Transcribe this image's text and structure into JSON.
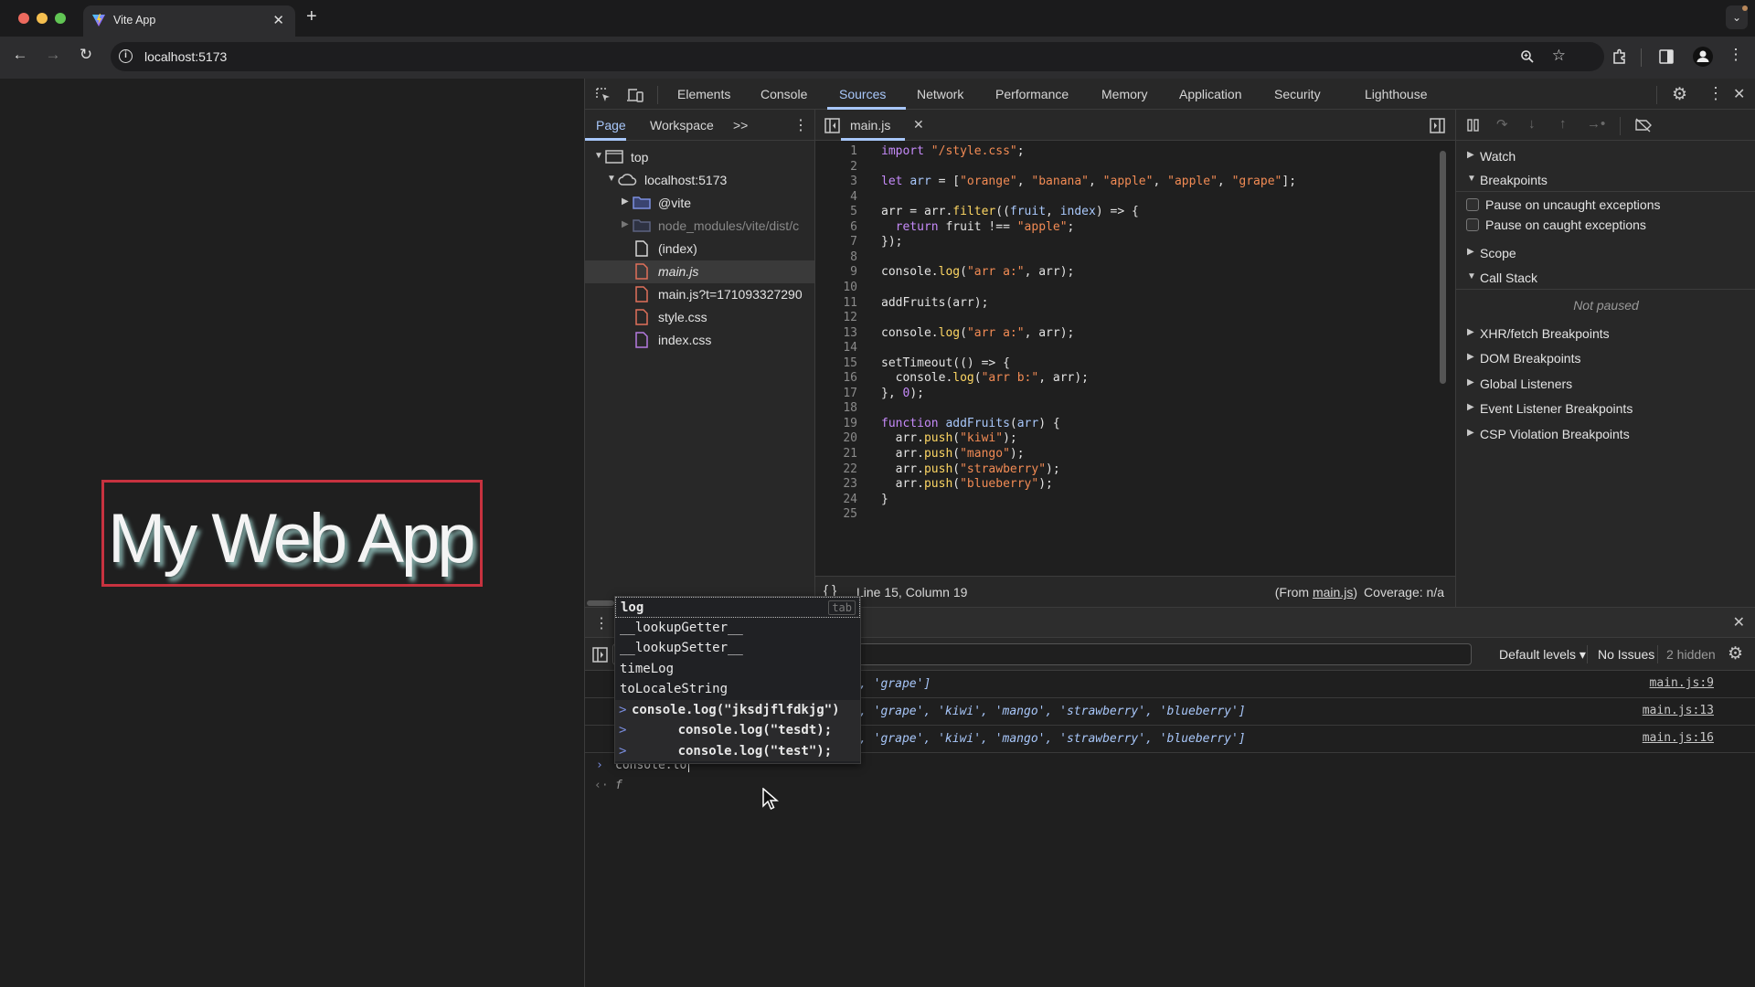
{
  "browser": {
    "tab_title": "Vite App",
    "url": "localhost:5173",
    "traffic_colors": {
      "close": "#ed6a5e",
      "minimize": "#f5bf4f",
      "maximize": "#61c554"
    }
  },
  "webpage": {
    "heading": "My Web App",
    "border_color": "#c7323f"
  },
  "devtools": {
    "tabs": [
      "Elements",
      "Console",
      "Sources",
      "Network",
      "Performance",
      "Memory",
      "Application",
      "Security",
      "Lighthouse"
    ],
    "active_tab": "Sources",
    "accent": "#a8c7fa",
    "navigator": {
      "tabs": [
        "Page",
        "Workspace"
      ],
      "more": ">>",
      "tree": [
        {
          "label": "top",
          "icon": "frame-icon",
          "depth": 0,
          "expanded": true
        },
        {
          "label": "localhost:5173",
          "icon": "cloud-icon",
          "depth": 1,
          "expanded": true
        },
        {
          "label": "@vite",
          "icon": "folder-icon",
          "depth": 2,
          "expanded": false
        },
        {
          "label": "node_modules/vite/dist/c",
          "icon": "folder-icon",
          "depth": 2,
          "expanded": false,
          "dim": true
        },
        {
          "label": "(index)",
          "icon": "file-icon",
          "depth": 2
        },
        {
          "label": "main.js",
          "icon": "js-file-icon",
          "depth": 2,
          "selected": true
        },
        {
          "label": "main.js?t=171093327290",
          "icon": "js-file-icon",
          "depth": 2
        },
        {
          "label": "style.css",
          "icon": "js-file-icon",
          "depth": 2
        },
        {
          "label": "index.css",
          "icon": "css-file-icon",
          "depth": 2
        }
      ]
    },
    "editor": {
      "open_file": "main.js",
      "lines": [
        "import \"/style.css\";",
        "",
        "let arr = [\"orange\", \"banana\", \"apple\", \"apple\", \"grape\"];",
        "",
        "arr = arr.filter((fruit, index) => {",
        "  return fruit !== \"apple\";",
        "});",
        "",
        "console.log(\"arr a:\", arr);",
        "",
        "addFruits(arr);",
        "",
        "console.log(\"arr a:\", arr);",
        "",
        "setTimeout(() => {",
        "  console.log(\"arr b:\", arr);",
        "}, 0);",
        "",
        "function addFruits(arr) {",
        "  arr.push(\"kiwi\");",
        "  arr.push(\"mango\");",
        "  arr.push(\"strawberry\");",
        "  arr.push(\"blueberry\");",
        "}",
        ""
      ],
      "status_position": "Line 15, Column 19",
      "status_from_prefix": "(From ",
      "status_from_link": "main.js",
      "status_from_suffix": ")",
      "status_coverage": "Coverage: n/a"
    },
    "debugger": {
      "watch": "Watch",
      "breakpoints": "Breakpoints",
      "pause_uncaught": "Pause on uncaught exceptions",
      "pause_caught": "Pause on caught exceptions",
      "scope": "Scope",
      "call_stack": "Call Stack",
      "not_paused": "Not paused",
      "more_sections": [
        "XHR/fetch Breakpoints",
        "DOM Breakpoints",
        "Global Listeners",
        "Event Listener Breakpoints",
        "CSP Violation Breakpoints"
      ]
    },
    "console": {
      "levels": "Default levels",
      "issues": "No Issues",
      "hidden": "2 hidden",
      "messages": [
        {
          "text": ", 'grape']",
          "source": "main.js:9"
        },
        {
          "text": ", 'grape', 'kiwi', 'mango', 'strawberry', 'blueberry']",
          "source": "main.js:13"
        },
        {
          "text": ", 'grape', 'kiwi', 'mango', 'strawberry', 'blueberry']",
          "source": "main.js:16"
        }
      ],
      "input_value": "console.lo",
      "result_preview": "f",
      "autocomplete": {
        "tab_hint": "tab",
        "suggestions": [
          "log",
          "__lookupGetter__",
          "__lookupSetter__",
          "timeLog",
          "toLocaleString"
        ],
        "history": [
          "console.log(\"jksdjflfdkjg\")",
          "      console.log(\"tesdt);",
          "      console.log(\"test\");"
        ]
      }
    }
  }
}
